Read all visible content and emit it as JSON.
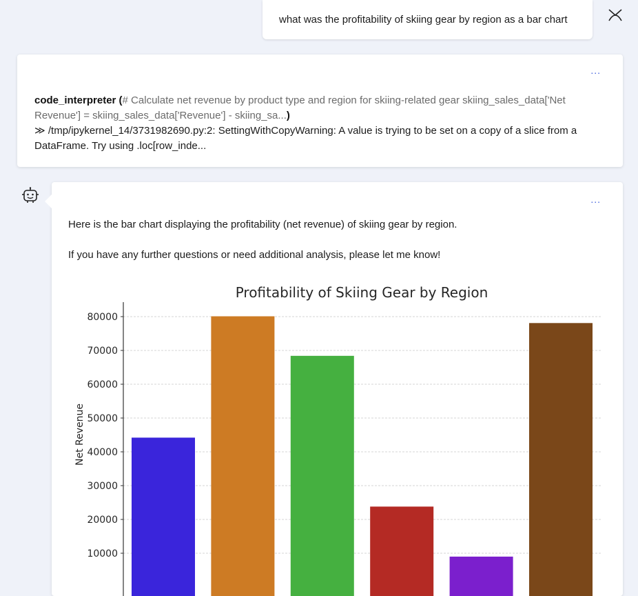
{
  "user_message": {
    "text": "what was the profitability of skiing gear by region as a bar chart"
  },
  "tool_call": {
    "name": "code_interpreter",
    "open_paren": " (",
    "code": "# Calculate net revenue by product type and region for skiing-related gear skiing_sales_data['Net Revenue'] = skiing_sales_data['Revenue'] - skiing_sa...",
    "close_paren": ")",
    "output_arrow": "≫",
    "output": " /tmp/ipykernel_14/3731982690.py:2: SettingWithCopyWarning: A value is trying to be set on a copy of a slice from a DataFrame. Try using .loc[row_inde...",
    "menu_label": "..."
  },
  "assistant_message": {
    "menu_label": "...",
    "line1": "Here is the bar chart displaying the profitability (net revenue) of skiing gear by region.",
    "line2": "If you have any further questions or need additional analysis, please let me know!"
  },
  "chart_data": {
    "type": "bar",
    "title": "Profitability of Skiing Gear by Region",
    "xlabel": "",
    "ylabel": "Net Revenue",
    "categories": [
      "",
      "",
      "",
      "",
      "",
      ""
    ],
    "values": [
      44200,
      80100,
      68400,
      23800,
      9000,
      78100
    ],
    "colors": [
      "#3a25db",
      "#cd7b24",
      "#45b040",
      "#b42a24",
      "#7b1fcd",
      "#7a4719"
    ],
    "yticks": [
      10000,
      20000,
      30000,
      40000,
      50000,
      60000,
      70000,
      80000
    ],
    "ylim": [
      0,
      84000
    ],
    "grid": true
  }
}
